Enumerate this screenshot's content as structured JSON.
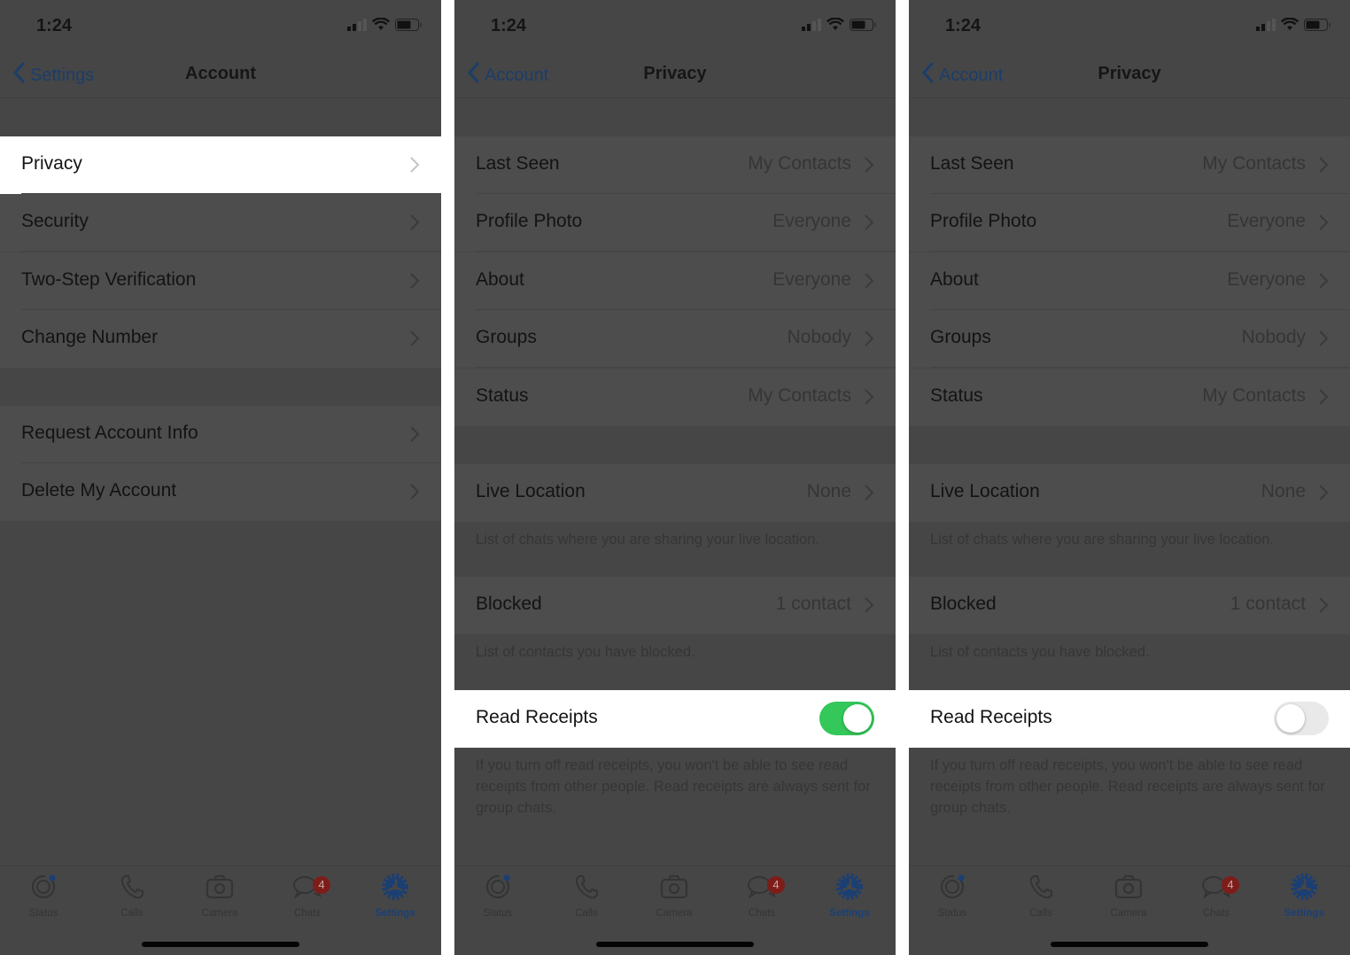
{
  "status_bar": {
    "time": "1:24"
  },
  "screens": [
    {
      "nav": {
        "back_label": "Settings",
        "title": "Account"
      },
      "groups": [
        [
          {
            "label": "Privacy",
            "highlighted": true
          },
          {
            "label": "Security"
          },
          {
            "label": "Two-Step Verification"
          },
          {
            "label": "Change Number"
          }
        ],
        [
          {
            "label": "Request Account Info"
          },
          {
            "label": "Delete My Account"
          }
        ]
      ]
    },
    {
      "nav": {
        "back_label": "Account",
        "title": "Privacy"
      },
      "rows": [
        {
          "label": "Last Seen",
          "value": "My Contacts"
        },
        {
          "label": "Profile Photo",
          "value": "Everyone"
        },
        {
          "label": "About",
          "value": "Everyone"
        },
        {
          "label": "Groups",
          "value": "Nobody"
        },
        {
          "label": "Status",
          "value": "My Contacts"
        }
      ],
      "live_location": {
        "label": "Live Location",
        "value": "None",
        "footer": "List of chats where you are sharing your live location."
      },
      "blocked": {
        "label": "Blocked",
        "value": "1 contact",
        "footer": "List of contacts you have blocked."
      },
      "read_receipts": {
        "label": "Read Receipts",
        "enabled": true,
        "footer": "If you turn off read receipts, you won't be able to see read receipts from other people. Read receipts are always sent for group chats."
      }
    },
    {
      "nav": {
        "back_label": "Account",
        "title": "Privacy"
      },
      "rows": [
        {
          "label": "Last Seen",
          "value": "My Contacts"
        },
        {
          "label": "Profile Photo",
          "value": "Everyone"
        },
        {
          "label": "About",
          "value": "Everyone"
        },
        {
          "label": "Groups",
          "value": "Nobody"
        },
        {
          "label": "Status",
          "value": "My Contacts"
        }
      ],
      "live_location": {
        "label": "Live Location",
        "value": "None",
        "footer": "List of chats where you are sharing your live location."
      },
      "blocked": {
        "label": "Blocked",
        "value": "1 contact",
        "footer": "List of contacts you have blocked."
      },
      "read_receipts": {
        "label": "Read Receipts",
        "enabled": false,
        "footer": "If you turn off read receipts, you won't be able to see read receipts from other people. Read receipts are always sent for group chats."
      }
    }
  ],
  "tab_bar": {
    "tabs": [
      {
        "label": "Status",
        "icon": "status-icon"
      },
      {
        "label": "Calls",
        "icon": "phone-icon"
      },
      {
        "label": "Camera",
        "icon": "camera-icon"
      },
      {
        "label": "Chats",
        "icon": "chat-bubbles-icon",
        "badge": "4"
      },
      {
        "label": "Settings",
        "icon": "gear-icon",
        "active": true
      }
    ]
  },
  "colors": {
    "accent": "#1b3f73",
    "toggle_on": "#34c759",
    "badge": "#7d1d1a",
    "dim_overlay_bg": "#4d4d4d"
  }
}
